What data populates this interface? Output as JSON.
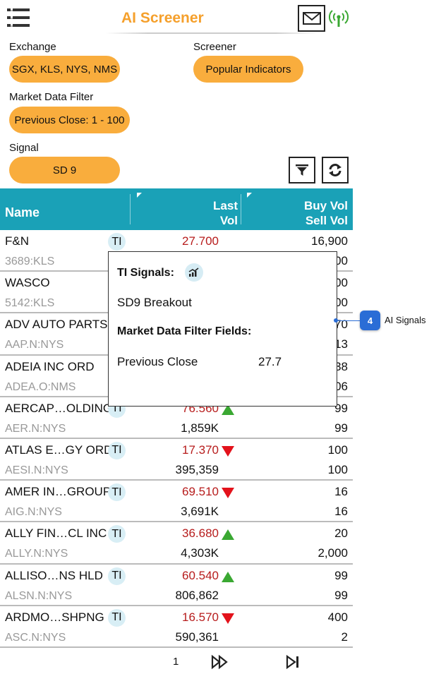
{
  "header": {
    "title": "AI Screener",
    "menu_icon": "hamburger-menu-icon",
    "mail_icon": "envelope-icon",
    "signal_icon": "broadcast-signal-icon"
  },
  "filters": {
    "exchange_label": "Exchange",
    "exchange_value": "SGX, KLS, NYS, NMS",
    "screener_label": "Screener",
    "screener_value": "Popular Indicators",
    "market_filter_label": "Market Data Filter",
    "market_filter_value": "Previous Close: 1 - 100",
    "signal_label": "Signal",
    "signal_value": "SD 9",
    "filter_icon": "funnel-icon",
    "refresh_icon": "refresh-icon"
  },
  "table": {
    "headers": {
      "name": "Name",
      "last": "Last",
      "vol": "Vol",
      "buy_vol": "Buy Vol",
      "sell_vol": "Sell Vol"
    },
    "rows": [
      {
        "name": "F&N",
        "code": "3689:KLS",
        "ti": "TI",
        "price": "27.700",
        "vol": "",
        "buy": "16,900",
        "sell": "00",
        "trend": ""
      },
      {
        "name": "WASCO",
        "code": "5142:KLS",
        "ti": "",
        "price": "",
        "vol": "",
        "buy": "00",
        "sell": "00",
        "trend": ""
      },
      {
        "name": "ADV AUTO PARTS",
        "code": "AAP.N:NYS",
        "ti": "",
        "price": "",
        "vol": "",
        "buy": "70",
        "sell": "13",
        "trend": ""
      },
      {
        "name": "ADEIA INC ORD",
        "code": "ADEA.O:NMS",
        "ti": "",
        "price": "",
        "vol": "",
        "buy": "38",
        "sell": "06",
        "trend": ""
      },
      {
        "name": "AERCAP…OLDING",
        "code": "AER.N:NYS",
        "ti": "TI",
        "price": "76.560",
        "vol": "1,859K",
        "buy": "99",
        "sell": "99",
        "trend": "up"
      },
      {
        "name": "ATLAS E…GY ORD",
        "code": "AESI.N:NYS",
        "ti": "TI",
        "price": "17.370",
        "vol": "395,359",
        "buy": "100",
        "sell": "100",
        "trend": "down"
      },
      {
        "name": "AMER IN…GROUP",
        "code": "AIG.N:NYS",
        "ti": "TI",
        "price": "69.510",
        "vol": "3,691K",
        "buy": "16",
        "sell": "16",
        "trend": "down"
      },
      {
        "name": "ALLY FIN…CL INC",
        "code": "ALLY.N:NYS",
        "ti": "TI",
        "price": "36.680",
        "vol": "4,303K",
        "buy": "20",
        "sell": "2,000",
        "trend": "up"
      },
      {
        "name": "ALLISO…NS HLD",
        "code": "ALSN.N:NYS",
        "ti": "TI",
        "price": "60.540",
        "vol": "806,862",
        "buy": "99",
        "sell": "99",
        "trend": "up"
      },
      {
        "name": "ARDMO…SHPNG",
        "code": "ASC.N:NYS",
        "ti": "TI",
        "price": "16.570",
        "vol": "590,361",
        "buy": "400",
        "sell": "2",
        "trend": "down"
      }
    ]
  },
  "popup": {
    "signals_title": "TI Signals:",
    "signals_icon": "chart-signal-icon",
    "signal_item": "SD9 Breakout",
    "fields_title": "Market Data Filter Fields:",
    "field_name": "Previous Close",
    "field_value": "27.7"
  },
  "callout": {
    "number": "4",
    "label": "AI Signals"
  },
  "pager": {
    "page": "1",
    "next_icon": "fast-forward-icon",
    "last_icon": "skip-to-end-icon"
  },
  "colors": {
    "accent": "#f9ad3d",
    "title": "#f5a02c",
    "table_header": "#1aa1b7",
    "price": "#b71c1c",
    "up": "#3aa832",
    "down": "#e3121b",
    "callout": "#2a6dd6"
  }
}
